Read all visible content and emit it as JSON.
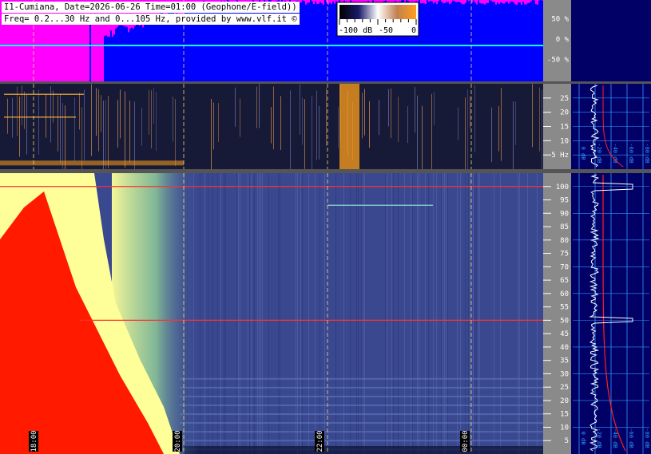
{
  "header": {
    "line1": "I1-Cumiana, Date=2026-06-26 Time=01:00 (Geophone/E-field))",
    "line2": "Freq= 0.2...30 Hz and 0...105 Hz, provided by www.vlf.it ©"
  },
  "colorbar": {
    "label_min": "-100 dB",
    "label_mid": "-50",
    "label_max": "0",
    "colors": [
      "#000000",
      "#1a1a6a",
      "#ffffff",
      "#c08050",
      "#ff9f1a"
    ]
  },
  "colors": {
    "magenta": "#ff00ff",
    "blue": "#0000ff",
    "cyan": "#00ffff",
    "panel_bg": "#000066",
    "spectrum_line": "#ffffff",
    "reference_line": "#ff2020",
    "grid": "#3399ff",
    "marker": "#ffffff",
    "hum_line": "#ff3030"
  },
  "chart_data": [
    {
      "type": "area",
      "id": "amplitude-strip",
      "y_axis": {
        "ticks": [
          "50 %",
          "0 %",
          "-50 %"
        ],
        "values": [
          50,
          0,
          -50
        ],
        "ylim": [
          -100,
          100
        ]
      },
      "x_time_markers": [
        "18:00",
        "20:00",
        "22:00",
        "00:00"
      ]
    },
    {
      "type": "heatmap",
      "id": "geophone-spectrogram",
      "ylabel": "Hz",
      "ylim": [
        0,
        30
      ],
      "y_ticks": [
        {
          "value": 25,
          "label": "25"
        },
        {
          "value": 20,
          "label": "20"
        },
        {
          "value": 15,
          "label": "15"
        },
        {
          "value": 10,
          "label": "10"
        },
        {
          "value": 5,
          "label": "5 Hz"
        }
      ],
      "x_time_markers": [
        "18:00",
        "20:00",
        "22:00",
        "00:00"
      ]
    },
    {
      "type": "heatmap",
      "id": "efield-spectrogram",
      "ylim": [
        0,
        105
      ],
      "y_ticks": [
        100,
        95,
        90,
        85,
        80,
        75,
        70,
        65,
        60,
        55,
        50,
        45,
        40,
        35,
        30,
        25,
        20,
        15,
        10,
        5
      ],
      "x_time_markers": [
        "18:00",
        "20:00",
        "22:00",
        "00:00"
      ],
      "notable_lines_hz": [
        100,
        50,
        93
      ]
    },
    {
      "type": "line",
      "id": "geophone-average-spectrum",
      "x_ticks": [
        "0 dB",
        "-20 dB",
        "-40 dB",
        "-60 dB",
        "-80 dB"
      ],
      "ylim": [
        0,
        30
      ]
    },
    {
      "type": "line",
      "id": "efield-average-spectrum",
      "x_ticks": [
        "0 dB",
        "-20 dB",
        "-40 dB",
        "-60 dB",
        "-80 dB"
      ],
      "ylim": [
        0,
        105
      ],
      "peaks_hz": [
        50,
        100
      ]
    }
  ]
}
